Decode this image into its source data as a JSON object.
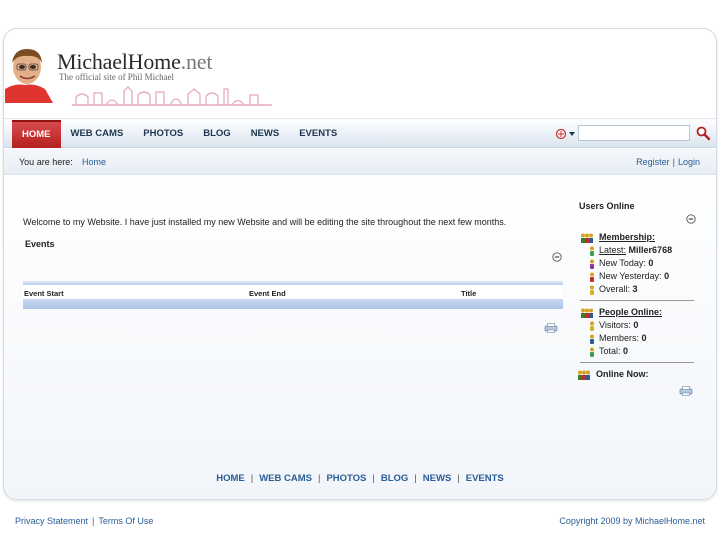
{
  "header": {
    "brand_main": "MichaelHome",
    "brand_tld": ".net",
    "tagline": "The official site of Phil Michael"
  },
  "nav": {
    "items": [
      {
        "label": "HOME",
        "active": true
      },
      {
        "label": "WEB CAMS",
        "active": false
      },
      {
        "label": "PHOTOS",
        "active": false
      },
      {
        "label": "BLOG",
        "active": false
      },
      {
        "label": "NEWS",
        "active": false
      },
      {
        "label": "EVENTS",
        "active": false
      }
    ],
    "search_value": ""
  },
  "breadcrumb": {
    "label": "You are here:",
    "current": "Home"
  },
  "auth": {
    "register": "Register",
    "separator": "|",
    "login": "Login"
  },
  "main": {
    "welcome": "Welcome to my Website.  I have just installed my new Website and will be editing the site throughout the next few months.",
    "events": {
      "title": "Events",
      "columns": [
        "Event Start",
        "Event End",
        "Title"
      ]
    }
  },
  "users_online": {
    "title": "Users Online",
    "membership": {
      "label": "Membership:",
      "latest_label": "Latest:",
      "latest_value": "Miller6768",
      "new_today_label": "New Today:",
      "new_today_value": "0",
      "new_yesterday_label": "New Yesterday:",
      "new_yesterday_value": "0",
      "overall_label": "Overall:",
      "overall_value": "3"
    },
    "people": {
      "label": "People Online:",
      "visitors_label": "Visitors:",
      "visitors_value": "0",
      "members_label": "Members:",
      "members_value": "0",
      "total_label": "Total:",
      "total_value": "0"
    },
    "online_now_label": "Online Now:"
  },
  "footer_nav": [
    "HOME",
    "WEB CAMS",
    "PHOTOS",
    "BLOG",
    "NEWS",
    "EVENTS"
  ],
  "footer": {
    "privacy": "Privacy Statement",
    "separator": "|",
    "terms": "Terms Of Use",
    "copyright": "Copyright 2009 by MichaelHome.net"
  },
  "colors": {
    "accent_red": "#c62b2b",
    "link_blue": "#2a5d95",
    "nav_text": "#1e3550"
  }
}
